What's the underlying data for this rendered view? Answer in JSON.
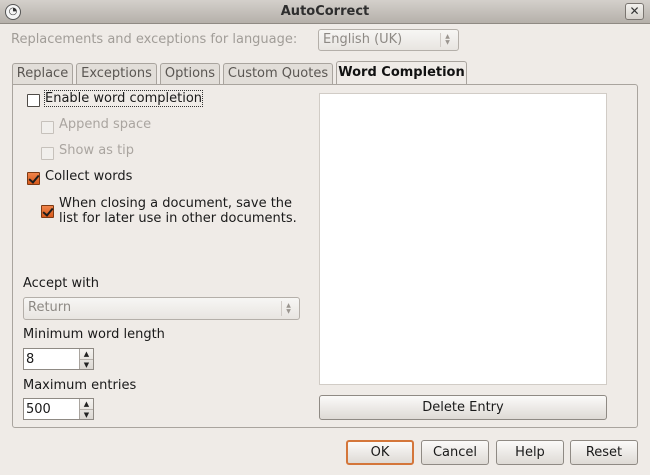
{
  "window": {
    "title": "AutoCorrect",
    "close_glyph": "✕",
    "app_icon_glyph": "◔"
  },
  "language": {
    "label": "Replacements and exceptions for language:",
    "value": "English (UK)"
  },
  "tabs": [
    {
      "label": "Replace",
      "active": false
    },
    {
      "label": "Exceptions",
      "active": false
    },
    {
      "label": "Options",
      "active": false
    },
    {
      "label": "Custom Quotes",
      "active": false
    },
    {
      "label": "Word Completion",
      "active": true
    }
  ],
  "options": {
    "enable": {
      "label": "Enable word completion",
      "checked": false,
      "enabled": true
    },
    "append_space": {
      "label": "Append space",
      "checked": false,
      "enabled": false
    },
    "show_as_tip": {
      "label": "Show as tip",
      "checked": false,
      "enabled": false
    },
    "collect_words": {
      "label": "Collect words",
      "checked": true,
      "enabled": true
    },
    "save_list": {
      "line1": "When closing a document, save the",
      "line2": "list for later use in other documents.",
      "checked": true,
      "enabled": true
    }
  },
  "accept_with": {
    "label": "Accept with",
    "value": "Return"
  },
  "min_word_length": {
    "label": "Minimum word length",
    "value": "8"
  },
  "max_entries": {
    "label": "Maximum entries",
    "value": "500"
  },
  "buttons": {
    "delete_entry": "Delete Entry",
    "ok": "OK",
    "cancel": "Cancel",
    "help": "Help",
    "reset": "Reset"
  },
  "colors": {
    "accent": "#d4763a",
    "background": "#efebe7"
  }
}
